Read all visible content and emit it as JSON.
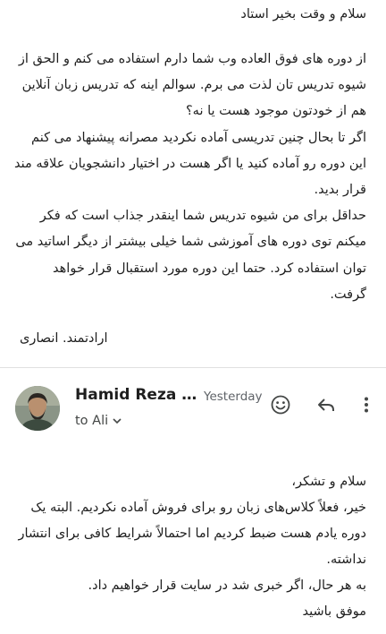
{
  "previous_message": {
    "greeting": "سلام و وقت بخیر استاد",
    "paragraphs": [
      "از دوره های فوق العاده وب شما دارم استفاده می کنم و الحق از شیوه تدریس تان لذت می برم. سوالم اینه که تدریس زبان آنلاین هم از خودتون موجود هست یا نه؟",
      "اگر تا بحال چنین تدریسی آماده نکردید مصرانه پیشنهاد می کنم این دوره رو آماده کنید یا اگر هست در اختیار دانشجویان علاقه مند قرار بدید.",
      "حداقل برای من شیوه تدریس شما اینقدر جذاب است که فکر میکنم توی دوره های آموزشی شما خیلی بیشتر از دیگر اساتید می توان استفاده کرد. حتما این دوره مورد استقبال قرار خواهد گرفت."
    ],
    "signoff": "ارادتمند. انصاری"
  },
  "reply": {
    "sender_name": "Hamid Reza Ni...",
    "timestamp": "Yesterday",
    "recipient": "to Ali",
    "icons": {
      "avatar": "avatar-photo",
      "emoji": "smiley-icon",
      "reply": "reply-arrow-icon",
      "more": "more-vert-icon",
      "expand": "chevron-down-icon"
    },
    "lines": [
      "سلام و تشکر،",
      "خیر، فعلاً کلاس‌های زبان رو برای فروش آماده نکردیم. البته یک دوره یادم هست ضبط کردیم اما احتمالاً شرایط کافی برای انتشار نداشته.",
      "به هر حال، اگر خبری شد در سایت قرار خواهیم داد.",
      "موفق باشید"
    ]
  },
  "colors": {
    "text": "#1f1f1f",
    "secondary_text": "#5f6368",
    "divider": "#e0e0e0",
    "icon": "#444746"
  }
}
